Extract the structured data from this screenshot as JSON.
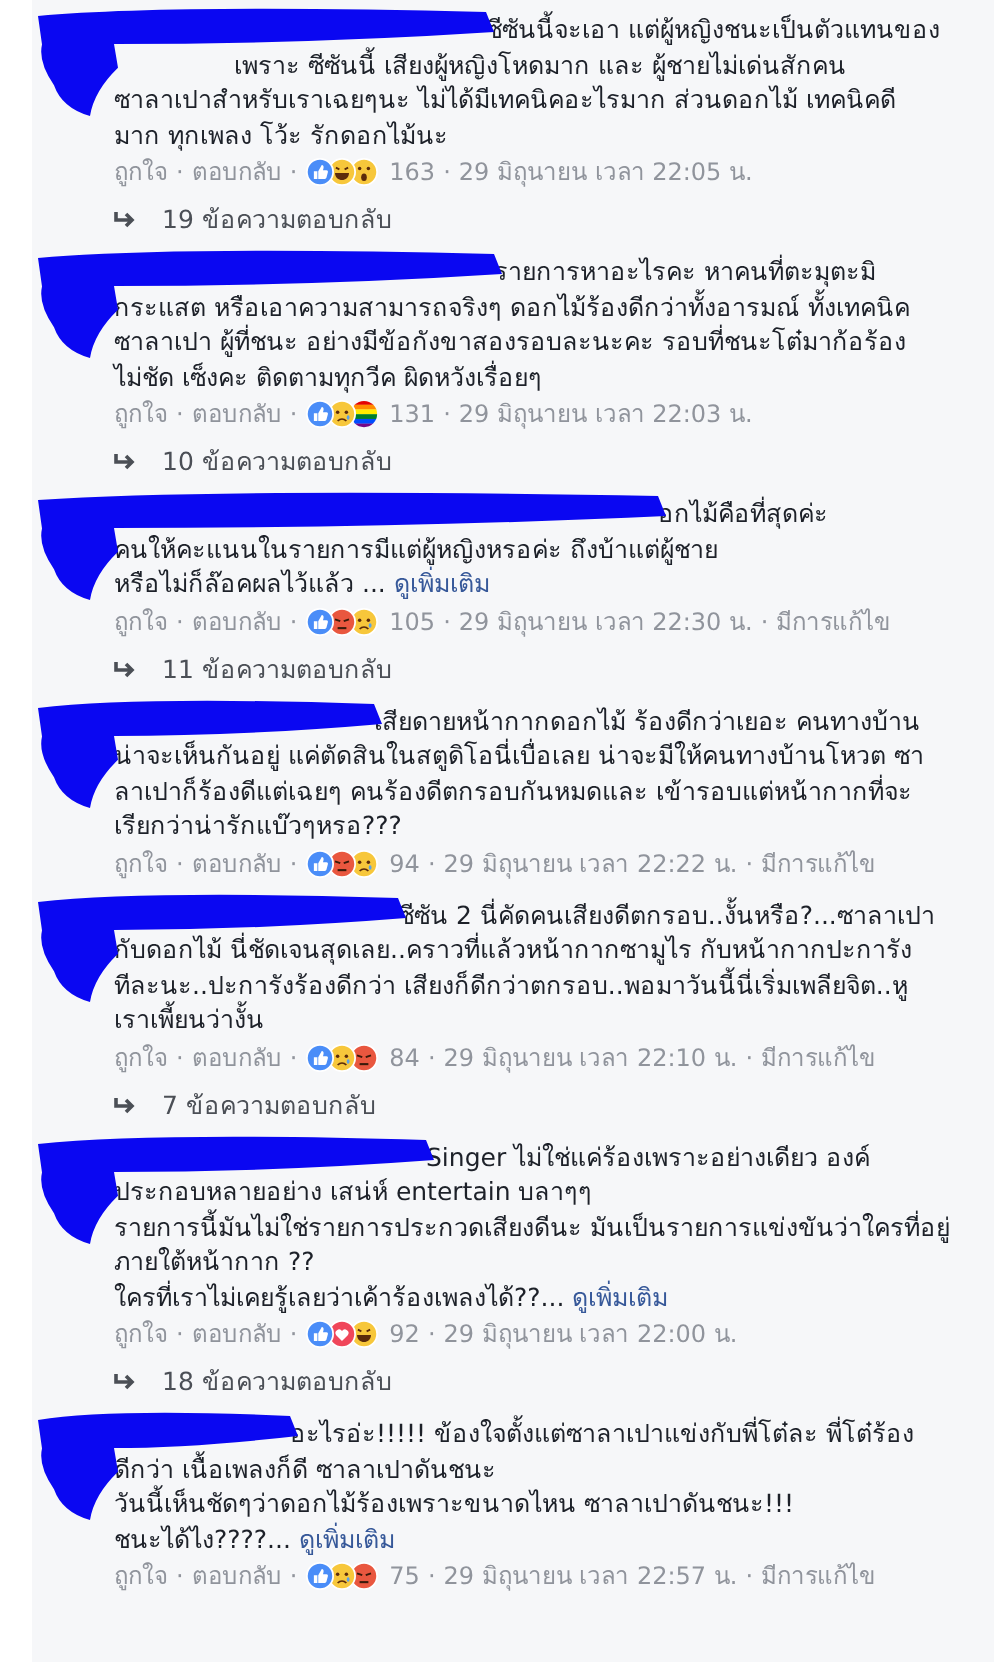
{
  "separator": "·",
  "comments": [
    {
      "lines": [
        "ซีซันนี้จะเอา แต่ผู้หญิงชนะเป็นตัวแทนของ",
        "เพราะ ซีซันนี้ เสียงผู้หญิงโหดมาก และ ผู้ชายไม่เด่นสักคน",
        "ซาลาเปาสำหรับเราเฉยๆนะ ไม่ได้มีเทคนิคอะไรมาก ส่วนดอกไม้ เทคนิคดี",
        "มาก ทุกเพลง โว้ะ รักดอกไม้นะ"
      ],
      "like": "ถูกใจ",
      "reply": "ตอบกลับ",
      "reactions": [
        {
          "kind": "like"
        },
        {
          "kind": "haha"
        },
        {
          "kind": "wow"
        }
      ],
      "count": "163",
      "time": "29 มิถุนายน เวลา 22:05 น.",
      "replies": "19 ข้อความตอบกลับ"
    },
    {
      "lines": [
        "รายการหาอะไรคะ หาคนที่ตะมุตะมิ",
        "กระแสต หรือเอาความสามารถจริงๆ ดอกไม้ร้องดีกว่าทั้งอารมณ์ ทั้งเทคนิค",
        "ซาลาเปา ผู้ที่ชนะ อย่างมีข้อกังขาสองรอบละนะคะ รอบที่ชนะโต๋มาก้อร้อง",
        "ไม่ชัด เซ็งคะ ติดตามทุกวีค ผิดหวังเรื่อยๆ"
      ],
      "like": "ถูกใจ",
      "reply": "ตอบกลับ",
      "reactions": [
        {
          "kind": "like"
        },
        {
          "kind": "sad"
        },
        {
          "kind": "pride"
        }
      ],
      "count": "131",
      "time": "29 มิถุนายน เวลา 22:03 น.",
      "replies": "10 ข้อความตอบกลับ"
    },
    {
      "lines": [
        "อกไม้คือที่สุดค่ะ",
        "คนให้คะแนนในรายการมีแต่ผู้หญิงหรอค่ะ ถึงบ้าแต่ผู้ชาย",
        "หรือไม่ก็ล๊อคผลไว้แล้ว ..."
      ],
      "see_more": "ดูเพิ่มเติม",
      "like": "ถูกใจ",
      "reply": "ตอบกลับ",
      "reactions": [
        {
          "kind": "like"
        },
        {
          "kind": "angry"
        },
        {
          "kind": "sad"
        }
      ],
      "count": "105",
      "time": "29 มิถุนายน เวลา 22:30 น.",
      "edited": "มีการแก้ไข",
      "replies": "11 ข้อความตอบกลับ"
    },
    {
      "lines": [
        "เสียดายหน้ากากดอกไม้ ร้องดีกว่าเยอะ คนทางบ้าน",
        "น่าจะเห็นกันอยู่ แค่ตัดสินในสตูดิโอนี่เบื่อเลย น่าจะมีให้คนทางบ้านโหวต ซา",
        "ลาเปาก็ร้องดีแต่เฉยๆ คนร้องดีตกรอบกันหมดและ เข้ารอบแต่หน้ากากที่จะ",
        "เรียกว่าน่ารักแบ๊วๆหรอ???"
      ],
      "like": "ถูกใจ",
      "reply": "ตอบกลับ",
      "reactions": [
        {
          "kind": "like"
        },
        {
          "kind": "angry"
        },
        {
          "kind": "sad"
        }
      ],
      "count": "94",
      "time": "29 มิถุนายน เวลา 22:22 น.",
      "edited": "มีการแก้ไข"
    },
    {
      "lines": [
        "ซีซัน 2 นี่คัดคนเสียงดีตกรอบ..งั้นหรือ?...ซาลาเปา",
        "กับดอกไม้ นี่ชัดเจนสุดเลย..คราวที่แล้วหน้ากากซามูไร กับหน้ากากปะการัง",
        "ทีละนะ..ปะการังร้องดีกว่า เสียงก็ดีกว่าตกรอบ..พอมาวันนี้นี่เริ่มเพลียจิต..หู",
        "เราเพี้ยนว่างั้น"
      ],
      "like": "ถูกใจ",
      "reply": "ตอบกลับ",
      "reactions": [
        {
          "kind": "like"
        },
        {
          "kind": "sad"
        },
        {
          "kind": "angry"
        }
      ],
      "count": "84",
      "time": "29 มิถุนายน เวลา 22:10 น.",
      "edited": "มีการแก้ไข",
      "replies": "7 ข้อความตอบกลับ"
    },
    {
      "lines": [
        "Singer ไม่ใช่แค่ร้องเพราะอย่างเดียว องค์",
        "ประกอบหลายอย่าง เสน่ห์ entertain บลาๆๆ",
        "รายการนี้มันไม่ใช่รายการประกวดเสียงดีนะ มันเป็นรายการแข่งขันว่าใครที่อยู่",
        "ภายใต้หน้ากาก ??",
        "ใครที่เราไม่เคยรู้เลยว่าเค้าร้องเพลงได้??..."
      ],
      "see_more": "ดูเพิ่มเติม",
      "like": "ถูกใจ",
      "reply": "ตอบกลับ",
      "reactions": [
        {
          "kind": "like"
        },
        {
          "kind": "love"
        },
        {
          "kind": "haha"
        }
      ],
      "count": "92",
      "time": "29 มิถุนายน เวลา 22:00 น.",
      "replies": "18 ข้อความตอบกลับ"
    },
    {
      "lines": [
        "อะไรอ่ะ!!!!! ข้องใจตั้งแต่ซาลาเปาแข่งกับพี่โต๋ละ พี่โต๋ร้อง",
        "ดีกว่า เนื้อเพลงก็ดี ซาลาเปาดันชนะ",
        "วันนี้เห็นชัดๆว่าดอกไม้ร้องเพราะขนาดไหน ซาลาเปาดันชนะ!!!",
        "ชนะได้ไง????..."
      ],
      "see_more": "ดูเพิ่มเติม",
      "like": "ถูกใจ",
      "reply": "ตอบกลับ",
      "reactions": [
        {
          "kind": "like"
        },
        {
          "kind": "sad"
        },
        {
          "kind": "angry"
        }
      ],
      "count": "75",
      "time": "29 มิถุนายน เวลา 22:57 น.",
      "edited": "มีการแก้ไข"
    }
  ]
}
